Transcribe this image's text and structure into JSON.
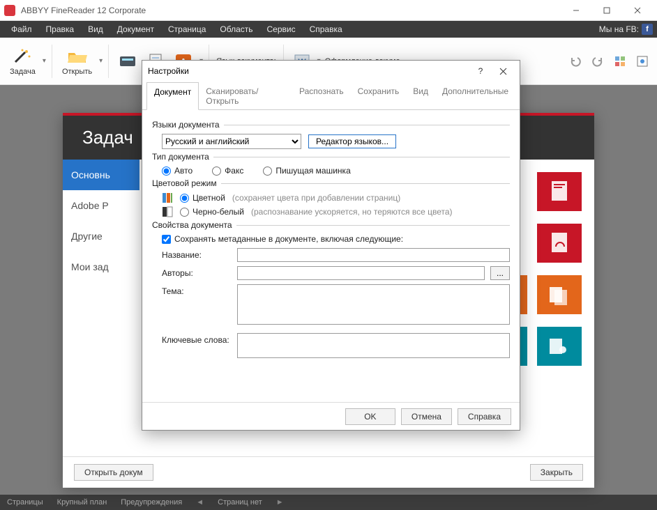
{
  "titlebar": {
    "title": "ABBYY FineReader 12 Corporate"
  },
  "menubar": {
    "items": [
      "Файл",
      "Правка",
      "Вид",
      "Документ",
      "Страница",
      "Область",
      "Сервис",
      "Справка"
    ],
    "fb_label": "Мы на FB:"
  },
  "toolbar": {
    "task": "Задача",
    "open": "Открыть",
    "lang_label": "Язык документа:",
    "format_label": "Оформление докуме..."
  },
  "task_window": {
    "title": "Задач",
    "nav": [
      "Основнь",
      "Adobe P",
      "Другие",
      "Мои зад"
    ],
    "open_doc_btn": "Открыть докум",
    "close_btn": "Закрыть"
  },
  "statusbar": {
    "pages": "Страницы",
    "zoom": "Крупный план",
    "warnings": "Предупреждения",
    "no_pages": "Страниц нет"
  },
  "dialog": {
    "title": "Настройки",
    "tabs": [
      "Документ",
      "Сканировать/Открыть",
      "Распознать",
      "Сохранить",
      "Вид",
      "Дополнительные"
    ],
    "groups": {
      "languages": {
        "legend": "Языки документа",
        "selected": "Русский и английский",
        "editor_btn": "Редактор языков..."
      },
      "doc_type": {
        "legend": "Тип документа",
        "options": [
          "Авто",
          "Факс",
          "Пишущая машинка"
        ],
        "selected_index": 0
      },
      "color_mode": {
        "legend": "Цветовой режим",
        "opt_color": "Цветной",
        "opt_color_hint": "(сохраняет цвета при добавлении страниц)",
        "opt_bw": "Черно-белый",
        "opt_bw_hint": "(распознавание ускоряется, но теряются все цвета)",
        "selected": "color"
      },
      "props": {
        "legend": "Свойства документа",
        "keep_meta": "Сохранять метаданные в документе, включая следующие:",
        "keep_meta_checked": true,
        "name_label": "Название:",
        "authors_label": "Авторы:",
        "subject_label": "Тема:",
        "keywords_label": "Ключевые слова:",
        "name": "",
        "authors": "",
        "subject": "",
        "keywords": ""
      }
    },
    "buttons": {
      "ok": "OK",
      "cancel": "Отмена",
      "help": "Справка"
    }
  }
}
